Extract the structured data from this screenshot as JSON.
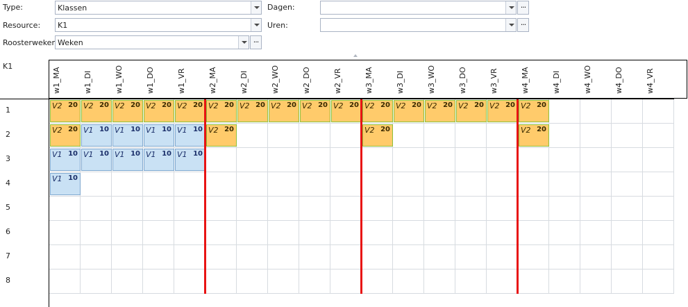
{
  "filters": {
    "type_label": "Type:",
    "type_value": "Klassen",
    "resource_label": "Resource:",
    "resource_value": "K1",
    "roosterweken_label": "Roosterweken:",
    "roosterweken_value": "Weken",
    "dagen_label": "Dagen:",
    "dagen_value": "",
    "uren_label": "Uren:",
    "uren_value": "",
    "dots": "..."
  },
  "schedule": {
    "resource": "K1",
    "columns": [
      "w1_MA",
      "w1_DI",
      "w1_WO",
      "w1_DO",
      "w1_VR",
      "w2_MA",
      "w2_DI",
      "w2_WO",
      "w2_DO",
      "w2_VR",
      "w3_MA",
      "w3_DI",
      "w3_WO",
      "w3_DO",
      "w3_VR",
      "w4_MA",
      "w4_DI",
      "w4_WO",
      "w4_DO",
      "w4_VR"
    ],
    "rows": [
      "1",
      "2",
      "3",
      "4",
      "5",
      "6",
      "7",
      "8"
    ],
    "colors": {
      "v2": "#ffcb6b",
      "v1": "#c9e1f4",
      "week_separator": "#e81313"
    },
    "blocks": [
      {
        "row": 0,
        "col": 0,
        "name": "V2",
        "count": "20",
        "kind": "v2"
      },
      {
        "row": 0,
        "col": 1,
        "name": "V2",
        "count": "20",
        "kind": "v2"
      },
      {
        "row": 0,
        "col": 2,
        "name": "V2",
        "count": "20",
        "kind": "v2"
      },
      {
        "row": 0,
        "col": 3,
        "name": "V2",
        "count": "20",
        "kind": "v2"
      },
      {
        "row": 0,
        "col": 4,
        "name": "V2",
        "count": "20",
        "kind": "v2"
      },
      {
        "row": 0,
        "col": 5,
        "name": "V2",
        "count": "20",
        "kind": "v2"
      },
      {
        "row": 0,
        "col": 6,
        "name": "V2",
        "count": "20",
        "kind": "v2"
      },
      {
        "row": 0,
        "col": 7,
        "name": "V2",
        "count": "20",
        "kind": "v2"
      },
      {
        "row": 0,
        "col": 8,
        "name": "V2",
        "count": "20",
        "kind": "v2"
      },
      {
        "row": 0,
        "col": 9,
        "name": "V2",
        "count": "20",
        "kind": "v2"
      },
      {
        "row": 0,
        "col": 10,
        "name": "V2",
        "count": "20",
        "kind": "v2"
      },
      {
        "row": 0,
        "col": 11,
        "name": "V2",
        "count": "20",
        "kind": "v2"
      },
      {
        "row": 0,
        "col": 12,
        "name": "V2",
        "count": "20",
        "kind": "v2"
      },
      {
        "row": 0,
        "col": 13,
        "name": "V2",
        "count": "20",
        "kind": "v2"
      },
      {
        "row": 0,
        "col": 14,
        "name": "V2",
        "count": "20",
        "kind": "v2"
      },
      {
        "row": 0,
        "col": 15,
        "name": "V2",
        "count": "20",
        "kind": "v2"
      },
      {
        "row": 1,
        "col": 0,
        "name": "V2",
        "count": "20",
        "kind": "v2"
      },
      {
        "row": 1,
        "col": 1,
        "name": "V1",
        "count": "10",
        "kind": "v1"
      },
      {
        "row": 1,
        "col": 2,
        "name": "V1",
        "count": "10",
        "kind": "v1"
      },
      {
        "row": 1,
        "col": 3,
        "name": "V1",
        "count": "10",
        "kind": "v1"
      },
      {
        "row": 1,
        "col": 4,
        "name": "V1",
        "count": "10",
        "kind": "v1"
      },
      {
        "row": 1,
        "col": 5,
        "name": "V2",
        "count": "20",
        "kind": "v2"
      },
      {
        "row": 1,
        "col": 10,
        "name": "V2",
        "count": "20",
        "kind": "v2"
      },
      {
        "row": 1,
        "col": 15,
        "name": "V2",
        "count": "20",
        "kind": "v2"
      },
      {
        "row": 2,
        "col": 0,
        "name": "V1",
        "count": "10",
        "kind": "v1"
      },
      {
        "row": 2,
        "col": 1,
        "name": "V1",
        "count": "10",
        "kind": "v1"
      },
      {
        "row": 2,
        "col": 2,
        "name": "V1",
        "count": "10",
        "kind": "v1"
      },
      {
        "row": 2,
        "col": 3,
        "name": "V1",
        "count": "10",
        "kind": "v1"
      },
      {
        "row": 2,
        "col": 4,
        "name": "V1",
        "count": "10",
        "kind": "v1"
      },
      {
        "row": 3,
        "col": 0,
        "name": "V1",
        "count": "10",
        "kind": "v1"
      }
    ]
  }
}
